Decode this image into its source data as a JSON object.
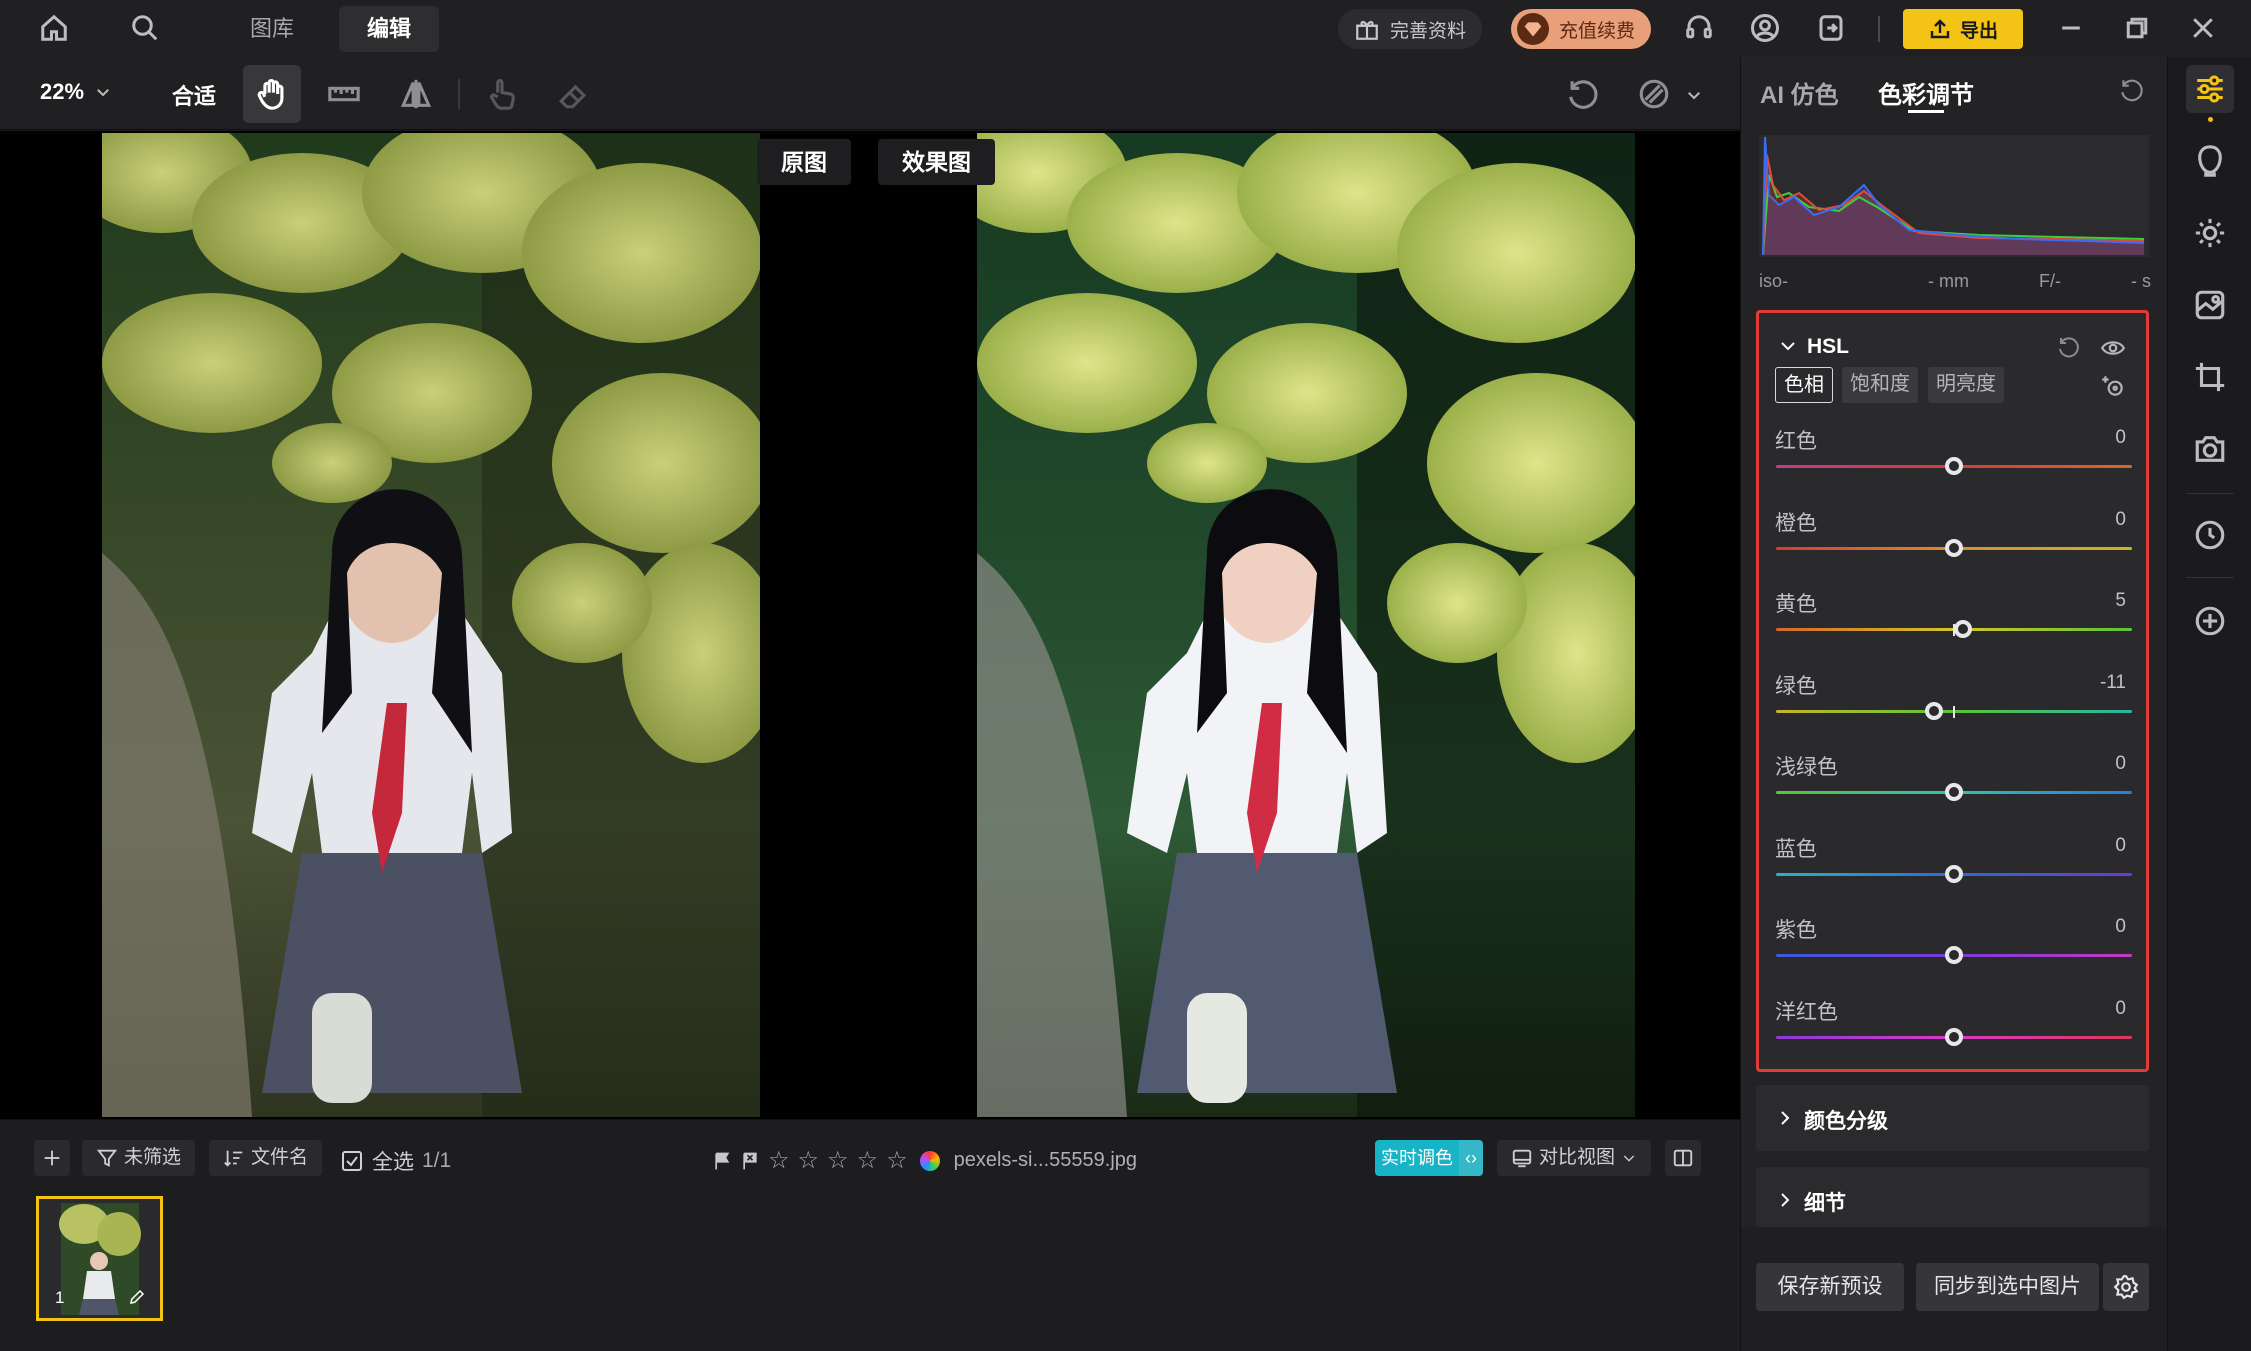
{
  "app": {
    "tabs": [
      {
        "label": "图库"
      },
      {
        "label": "编辑"
      }
    ],
    "profile_label": "完善资料",
    "vip_label": "充值续费",
    "export_label": "导出"
  },
  "toolbar": {
    "zoom": "22%",
    "fit_label": "合适"
  },
  "canvas": {
    "original_label": "原图",
    "result_label": "效果图"
  },
  "filmstrip": {
    "filter_label": "未筛选",
    "sort_label": "文件名",
    "select_all_label": "全选",
    "count": "1/1",
    "filename": "pexels-si...55559.jpg",
    "realtime_label": "实时调色",
    "compare_label": "对比视图",
    "thumb_index": "1"
  },
  "panel": {
    "tab_ai": "AI 仿色",
    "tab_color": "色彩调节",
    "histogram": {
      "iso": "iso-",
      "mm": "- mm",
      "f": "F/-",
      "s": "- s"
    },
    "hsl": {
      "title": "HSL",
      "subtabs": [
        "色相",
        "饱和度",
        "明亮度"
      ],
      "sliders": [
        {
          "label": "红色",
          "value": "0",
          "position": 0.5
        },
        {
          "label": "橙色",
          "value": "0",
          "position": 0.5
        },
        {
          "label": "黄色",
          "value": "5",
          "position": 0.525
        },
        {
          "label": "绿色",
          "value": "-11",
          "position": 0.445
        },
        {
          "label": "浅绿色",
          "value": "0",
          "position": 0.5
        },
        {
          "label": "蓝色",
          "value": "0",
          "position": 0.5
        },
        {
          "label": "紫色",
          "value": "0",
          "position": 0.5
        },
        {
          "label": "洋红色",
          "value": "0",
          "position": 0.5
        }
      ]
    },
    "sections": [
      {
        "title": "颜色分级"
      },
      {
        "title": "细节"
      }
    ],
    "save_preset_label": "保存新预设",
    "sync_label": "同步到选中图片"
  },
  "colors": {
    "accent_yellow": "#f3c315",
    "highlight_red": "#e23b3b",
    "realtime_teal": "#17b3c6"
  }
}
